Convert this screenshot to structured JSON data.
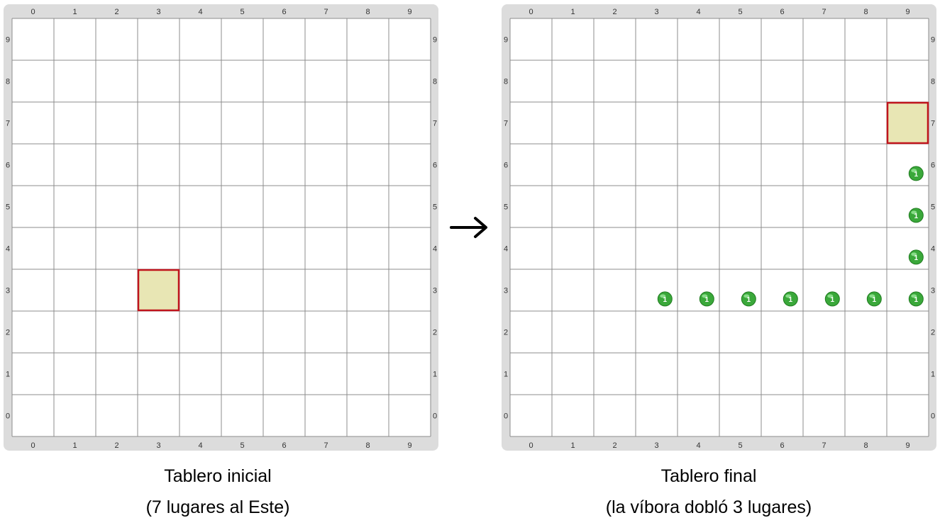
{
  "boards": [
    {
      "col_labels": [
        "0",
        "1",
        "2",
        "3",
        "4",
        "5",
        "6",
        "7",
        "8",
        "9"
      ],
      "row_labels": [
        "0",
        "1",
        "2",
        "3",
        "4",
        "5",
        "6",
        "7",
        "8",
        "9"
      ],
      "highlight_cell": {
        "col": 3,
        "row": 3
      },
      "balls": [],
      "caption_line1": "Tablero inicial",
      "caption_line2": "(7 lugares al Este)"
    },
    {
      "col_labels": [
        "0",
        "1",
        "2",
        "3",
        "4",
        "5",
        "6",
        "7",
        "8",
        "9"
      ],
      "row_labels": [
        "0",
        "1",
        "2",
        "3",
        "4",
        "5",
        "6",
        "7",
        "8",
        "9"
      ],
      "highlight_cell": {
        "col": 9,
        "row": 7
      },
      "balls": [
        {
          "col": 3,
          "row": 3,
          "count": "1"
        },
        {
          "col": 4,
          "row": 3,
          "count": "1"
        },
        {
          "col": 5,
          "row": 3,
          "count": "1"
        },
        {
          "col": 6,
          "row": 3,
          "count": "1"
        },
        {
          "col": 7,
          "row": 3,
          "count": "1"
        },
        {
          "col": 8,
          "row": 3,
          "count": "1"
        },
        {
          "col": 9,
          "row": 3,
          "count": "1"
        },
        {
          "col": 9,
          "row": 4,
          "count": "1"
        },
        {
          "col": 9,
          "row": 5,
          "count": "1"
        },
        {
          "col": 9,
          "row": 6,
          "count": "1"
        }
      ],
      "caption_line1": "Tablero final",
      "caption_line2": "(la víbora dobló 3 lugares)"
    }
  ],
  "colors": {
    "board_frame": "#dcdcdc",
    "grid_line": "#8c8c8c",
    "highlight_fill": "#e8e6b4",
    "highlight_border": "#c0141c",
    "ball_green": "#3aa83a"
  },
  "arrow_icon": "right-arrow-icon"
}
